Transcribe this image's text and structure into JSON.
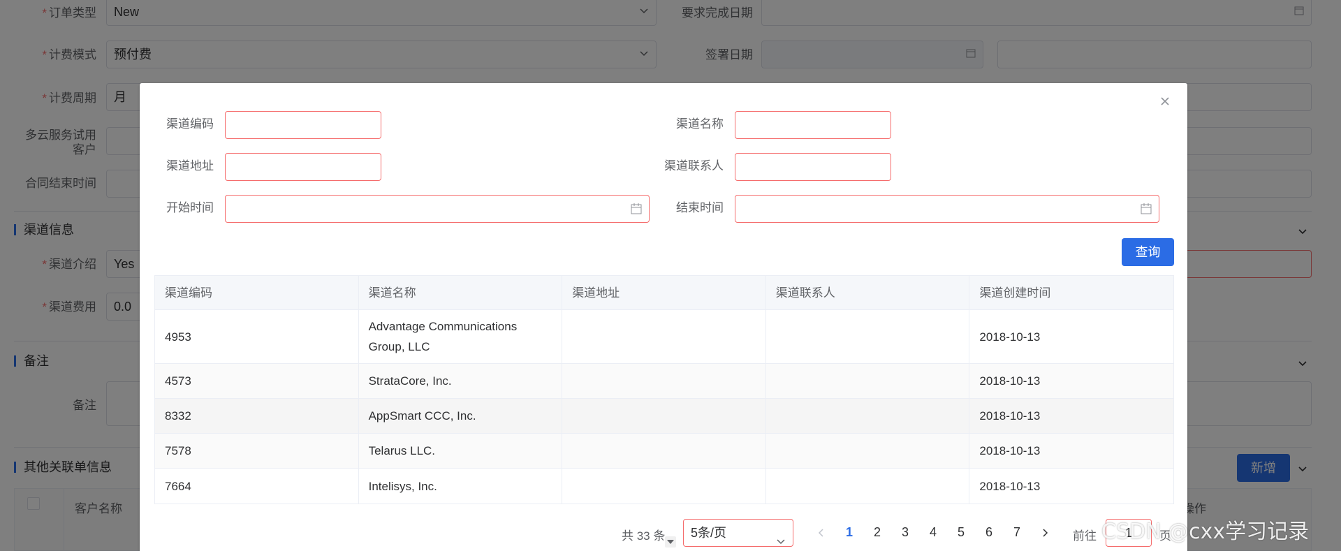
{
  "background_form": {
    "fields": [
      {
        "label": "订单类型",
        "required": true,
        "value": "New"
      },
      {
        "label": "计费模式",
        "required": true,
        "value": "预付费"
      },
      {
        "label": "计费周期",
        "required": true,
        "value": "月"
      },
      {
        "label": "多云服务试用客户",
        "required": false,
        "value": ""
      },
      {
        "label": "合同结束时间",
        "required": false,
        "value": ""
      }
    ],
    "right_fields": [
      {
        "label": "要求完成日期"
      },
      {
        "label": "签署日期"
      }
    ],
    "sections": {
      "channel_info": "渠道信息",
      "remarks": "备注",
      "other_orders": "其他关联单信息"
    },
    "channel_fields": [
      {
        "label": "渠道介绍",
        "required": true,
        "value": "Yes"
      },
      {
        "label": "渠道费用",
        "required": true,
        "value": "0.0"
      }
    ],
    "remarks_label": "备注",
    "add_button": "新增",
    "table_headers": {
      "customer_name": "客户名称",
      "action": "操作"
    }
  },
  "dialog": {
    "filters": {
      "channel_code": "渠道编码",
      "channel_name": "渠道名称",
      "channel_address": "渠道地址",
      "channel_contact": "渠道联系人",
      "start_time": "开始时间",
      "end_time": "结束时间"
    },
    "query_button": "查询",
    "table": {
      "columns": [
        "渠道编码",
        "渠道名称",
        "渠道地址",
        "渠道联系人",
        "渠道创建时间"
      ],
      "rows": [
        {
          "code": "4953",
          "name": "Advantage Communications Group, LLC",
          "address": "",
          "contact": "",
          "created": "2018-10-13"
        },
        {
          "code": "4573",
          "name": "StrataCore, Inc.",
          "address": "",
          "contact": "",
          "created": "2018-10-13"
        },
        {
          "code": "8332",
          "name": "AppSmart CCC, Inc.",
          "address": "",
          "contact": "",
          "created": "2018-10-13"
        },
        {
          "code": "7578",
          "name": "Telarus LLC.",
          "address": "",
          "contact": "",
          "created": "2018-10-13"
        },
        {
          "code": "7664",
          "name": "Intelisys, Inc.",
          "address": "",
          "contact": "",
          "created": "2018-10-13"
        }
      ]
    },
    "pagination": {
      "total": "共 33 条",
      "page_size": "5条/页",
      "pages": [
        "1",
        "2",
        "3",
        "4",
        "5",
        "6",
        "7"
      ],
      "current_page": "1",
      "goto_label": "前往",
      "goto_value": "1",
      "page_unit": "页"
    }
  },
  "watermark": "CSDN @cxx学习记录",
  "colors": {
    "accent": "#2b6ce5",
    "error": "#f56c6c",
    "overlay": "rgba(0,0,0,0.5)"
  }
}
